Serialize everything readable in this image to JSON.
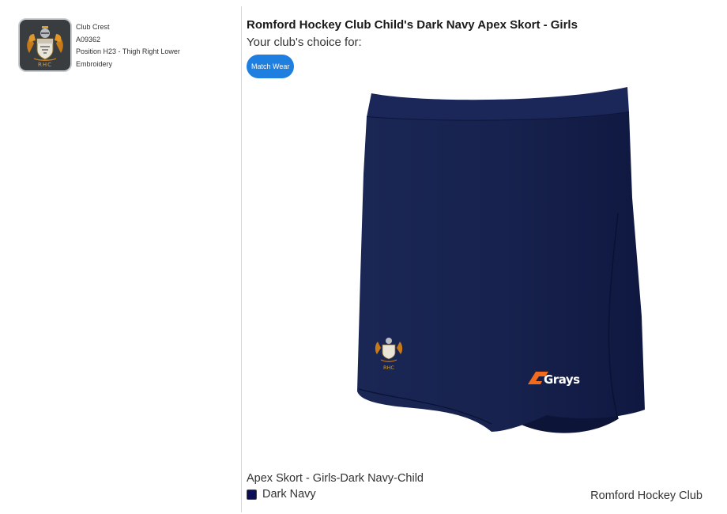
{
  "customisation": {
    "name": "Club Crest",
    "code": "A09362",
    "position": "Position H23 - Thigh Right Lower",
    "method": "Embroidery",
    "crest_letters": "RHC"
  },
  "product": {
    "title": "Romford Hockey Club Child's Dark Navy Apex Skort - Girls",
    "club_choice": "Your club's choice for:",
    "tag": "Match Wear",
    "brand_logo": "Grays",
    "variant": "Apex Skort - Girls-Dark Navy-Child",
    "colour_name": "Dark Navy",
    "club_name": "Romford Hockey Club"
  },
  "colors": {
    "accent": "#1e7fe0",
    "skort": "#141f4a",
    "swatch": "#0b0e57",
    "brand_orange": "#f26a1b"
  }
}
